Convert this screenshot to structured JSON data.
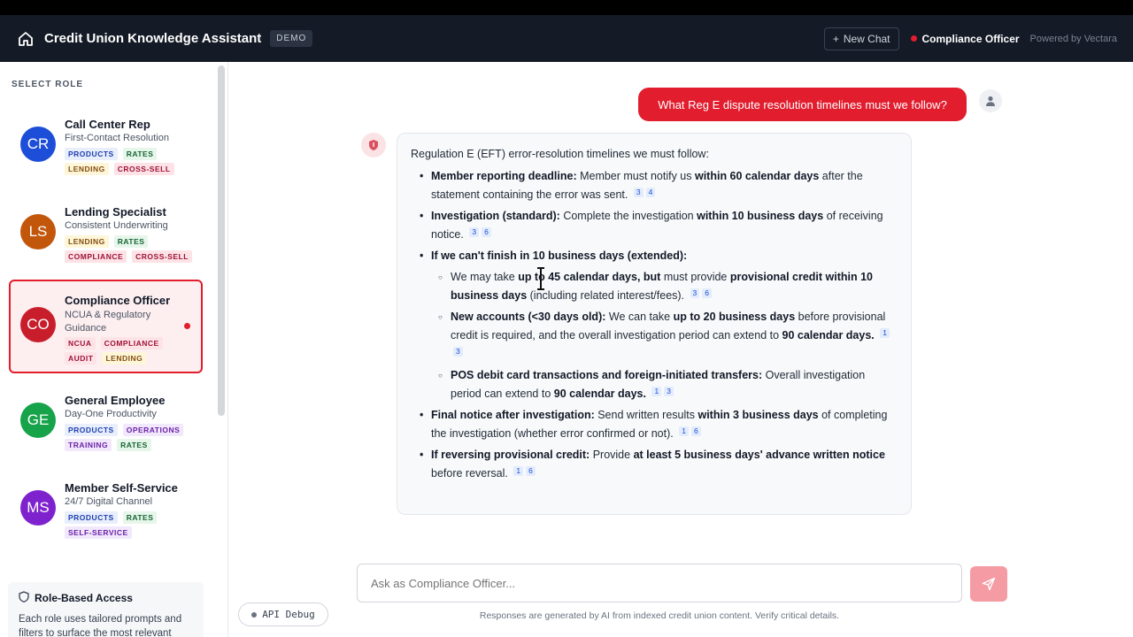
{
  "header": {
    "app_title": "Credit Union Knowledge Assistant",
    "badge": "DEMO",
    "new_chat": "New Chat",
    "active_role": "Compliance Officer",
    "powered_by": "Powered by Vectara",
    "background": "#141a26"
  },
  "sidebar": {
    "heading": "SELECT ROLE",
    "roles": [
      {
        "initials": "CR",
        "name": "Call Center Rep",
        "subtitle": "First-Contact Resolution",
        "color": "#1d4ed8",
        "tags": [
          "PRODUCTS",
          "RATES",
          "LENDING",
          "CROSS-SELL"
        ]
      },
      {
        "initials": "LS",
        "name": "Lending Specialist",
        "subtitle": "Consistent Underwriting",
        "color": "#c2570c",
        "tags": [
          "LENDING",
          "RATES",
          "COMPLIANCE",
          "CROSS-SELL"
        ]
      },
      {
        "initials": "CO",
        "name": "Compliance Officer",
        "subtitle": "NCUA & Regulatory Guidance",
        "color": "#c81e2c",
        "active": true,
        "tags": [
          "NCUA",
          "COMPLIANCE",
          "AUDIT",
          "LENDING"
        ]
      },
      {
        "initials": "GE",
        "name": "General Employee",
        "subtitle": "Day-One Productivity",
        "color": "#16a34a",
        "tags": [
          "PRODUCTS",
          "OPERATIONS",
          "TRAINING",
          "RATES"
        ]
      },
      {
        "initials": "MS",
        "name": "Member Self-Service",
        "subtitle": "24/7 Digital Channel",
        "color": "#7e22ce",
        "tags": [
          "PRODUCTS",
          "RATES",
          "SELF-SERVICE"
        ]
      }
    ],
    "rba_title": "Role-Based Access",
    "rba_text": "Each role uses tailored prompts and filters to surface the most relevant"
  },
  "chat": {
    "user_message": "What Reg E dispute resolution timelines must we follow?",
    "answer": {
      "intro": "Regulation E (EFT) error-resolution timelines we must follow:",
      "b1": {
        "bold": "Member reporting deadline:",
        "t1": " Member must notify us ",
        "bold2": "within 60 calendar days",
        "t2": " after the statement containing the error was sent.",
        "cites": [
          "3",
          "4"
        ]
      },
      "b2": {
        "bold": "Investigation (standard):",
        "t1": " Complete the investigation ",
        "bold2": "within 10 business days",
        "t2": " of receiving notice.",
        "cites": [
          "3",
          "6"
        ]
      },
      "b3": {
        "bold": "If we can't finish in 10 business days (extended):"
      },
      "s1": {
        "t1": "We may take ",
        "bold": "up to 45 calendar days, but",
        "t2": " must provide ",
        "bold2": "provisional credit within 10 business days",
        "t3": " (including related interest/fees).",
        "cites": [
          "3",
          "6"
        ]
      },
      "s2": {
        "bold": "New accounts (<30 days old):",
        "t1": " We can take ",
        "bold2": "up to 20 business days",
        "t2": " before provisional credit is required, and the overall investigation period can extend to ",
        "bold3": "90 calendar days.",
        "cites": [
          "1",
          "3"
        ]
      },
      "s3": {
        "bold": "POS debit card transactions and foreign-initiated transfers:",
        "t1": " Overall investigation period can extend to ",
        "bold2": "90 calendar days.",
        "cites": [
          "1",
          "3"
        ]
      },
      "b4": {
        "bold": "Final notice after investigation:",
        "t1": " Send written results ",
        "bold2": "within 3 business days",
        "t2": " of completing the investigation (whether error confirmed or not).",
        "cites": [
          "1",
          "6"
        ]
      },
      "b5": {
        "bold": "If reversing provisional credit:",
        "t1": " Provide ",
        "bold2": "at least 5 business days' advance written notice",
        "t2": " before reversal.",
        "cites": [
          "1",
          "6"
        ]
      }
    }
  },
  "footer": {
    "input_placeholder": "Ask as Compliance Officer...",
    "api_debug": "API Debug",
    "disclaimer": "Responses are generated by AI from indexed credit union content. Verify critical details."
  },
  "colors": {
    "accent": "#e11d2e",
    "send_button": "#f59ba3"
  }
}
